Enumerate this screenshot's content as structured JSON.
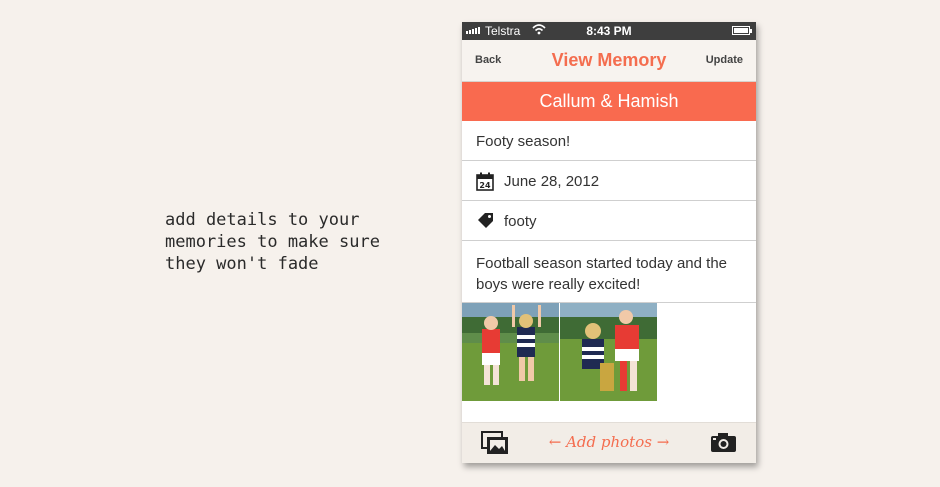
{
  "caption": {
    "lines": [
      "add details to your",
      "memories to make sure",
      "they won't fade"
    ]
  },
  "status_bar": {
    "carrier": "Telstra",
    "time": "8:43 PM",
    "signal_icon": "signal-bars-icon",
    "wifi_icon": "wifi-icon",
    "battery_icon": "battery-icon"
  },
  "nav": {
    "back_label": "Back",
    "title": "View Memory",
    "update_label": "Update"
  },
  "memory": {
    "people": "Callum & Hamish",
    "title": "Footy season!",
    "date": "June 28, 2012",
    "calendar_day": "24",
    "tag": "footy",
    "notes": "Football season started today and the boys were really excited!",
    "photos": [
      "photo-1",
      "photo-2"
    ]
  },
  "toolbar": {
    "add_photos_label": "← Add photos →",
    "gallery_icon": "photo-gallery-icon",
    "camera_icon": "camera-icon"
  },
  "colors": {
    "accent": "#f96a4f",
    "background": "#f6f1ec",
    "status_bar": "#3e3e3e"
  }
}
